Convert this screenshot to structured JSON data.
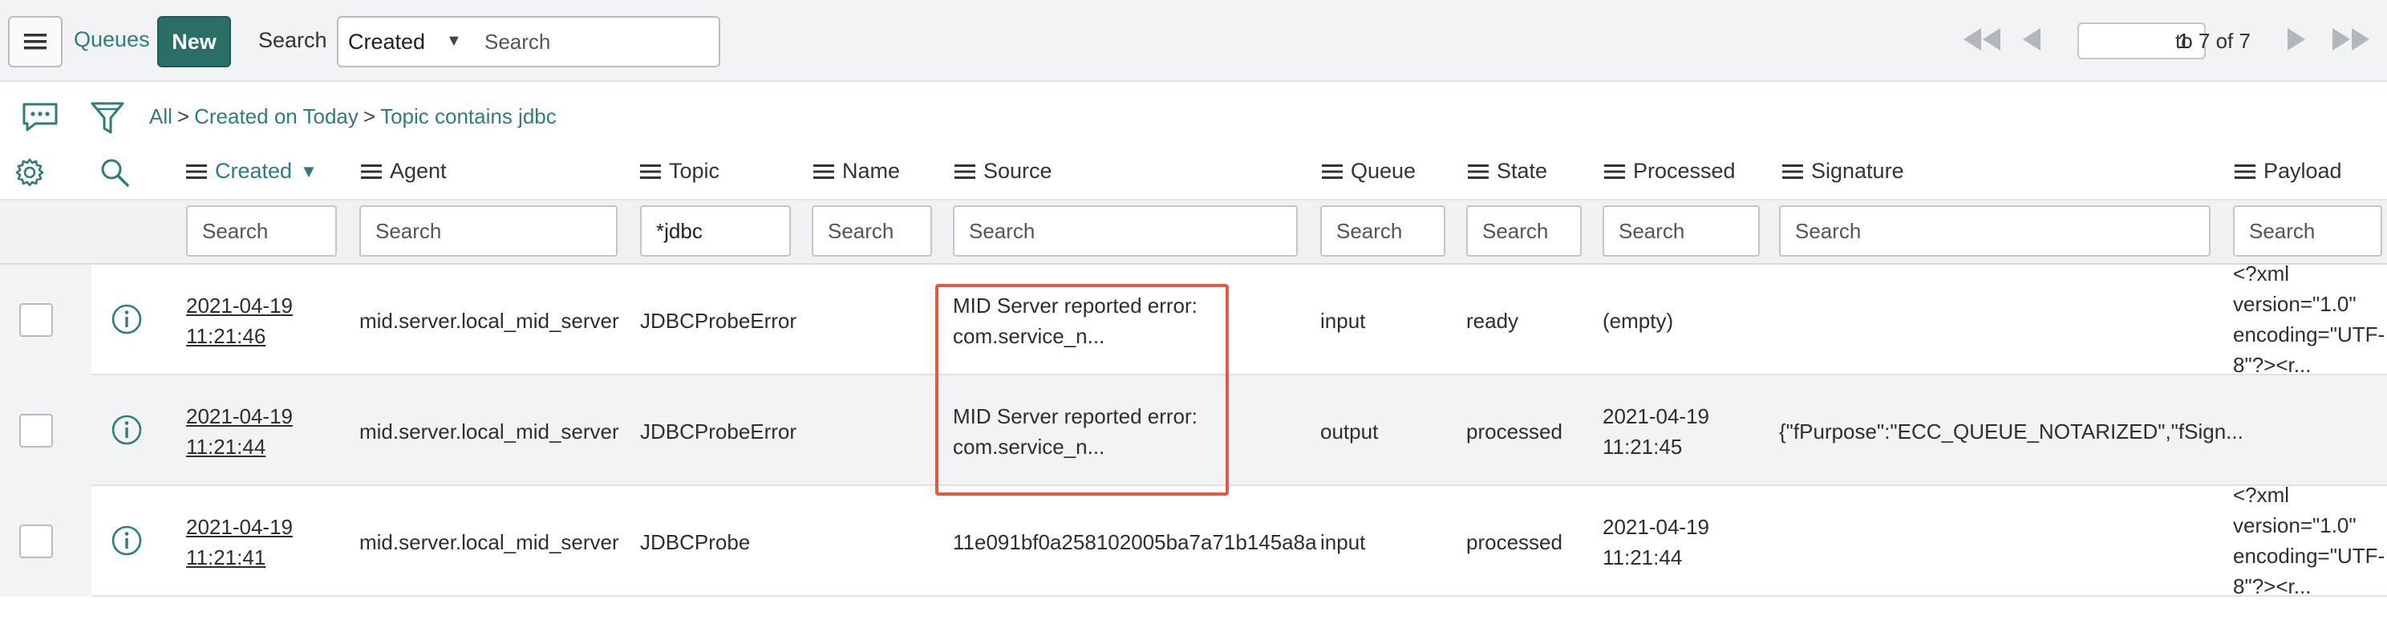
{
  "header": {
    "queues_label": "Queues",
    "new_label": "New",
    "search_label": "Search",
    "search_field_selected": "Created",
    "search_placeholder": "Search",
    "pager_page": "1",
    "pager_range": "to 7 of 7"
  },
  "breadcrumb": {
    "all": "All",
    "sep": ">",
    "crumb1": "Created on Today",
    "crumb2": "Topic contains jdbc"
  },
  "columns": {
    "created": "Created",
    "agent": "Agent",
    "topic": "Topic",
    "name": "Name",
    "source": "Source",
    "queue": "Queue",
    "state": "State",
    "processed": "Processed",
    "signature": "Signature",
    "payload": "Payload"
  },
  "filters": {
    "placeholder": "Search",
    "topic_value": "*jdbc"
  },
  "rows": [
    {
      "created_date": "2021-04-19",
      "created_time": "11:21:46",
      "agent": "mid.server.local_mid_server",
      "topic": "JDBCProbeError",
      "name": "",
      "source_line1": "MID Server reported error:",
      "source_line2": "com.service_n...",
      "queue": "input",
      "state": "ready",
      "processed_line1": "(empty)",
      "processed_line2": "",
      "signature": "",
      "payload_line1": "<?xml",
      "payload_line2": "version=\"1.0\"",
      "payload_line3": "encoding=\"UTF-",
      "payload_line4": "8\"?><r..."
    },
    {
      "created_date": "2021-04-19",
      "created_time": "11:21:44",
      "agent": "mid.server.local_mid_server",
      "topic": "JDBCProbeError",
      "name": "",
      "source_line1": "MID Server reported error:",
      "source_line2": "com.service_n...",
      "queue": "output",
      "state": "processed",
      "processed_line1": "2021-04-19",
      "processed_line2": "11:21:45",
      "signature": "{\"fPurpose\":\"ECC_QUEUE_NOTARIZED\",\"fSign...",
      "payload_line1": "",
      "payload_line2": "",
      "payload_line3": "",
      "payload_line4": ""
    },
    {
      "created_date": "2021-04-19",
      "created_time": "11:21:41",
      "agent": "mid.server.local_mid_server",
      "topic": "JDBCProbe",
      "name": "",
      "source_line1": "11e091bf0a258102005ba7a71b145a8a",
      "source_line2": "",
      "queue": "input",
      "state": "processed",
      "processed_line1": "2021-04-19",
      "processed_line2": "11:21:44",
      "signature": "",
      "payload_line1": "<?xml",
      "payload_line2": "version=\"1.0\"",
      "payload_line3": "encoding=\"UTF-",
      "payload_line4": "8\"?><r..."
    }
  ],
  "colors": {
    "accent": "#2e7d7b",
    "new_button": "#2a6e66",
    "highlight": "#e05a45"
  }
}
